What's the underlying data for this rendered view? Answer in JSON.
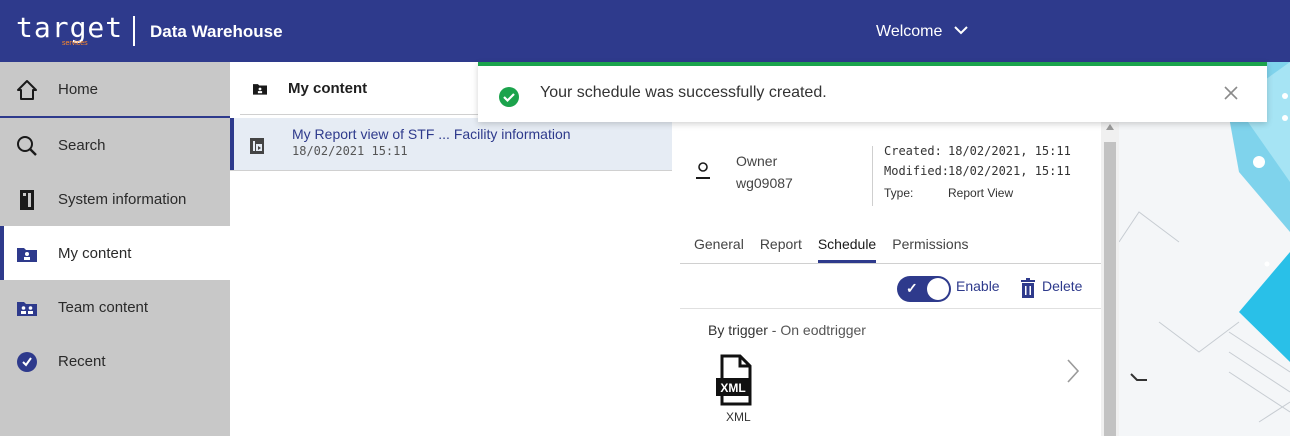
{
  "header": {
    "logo": "target",
    "logo_sub": "services",
    "app_title": "Data Warehouse",
    "welcome": "Welcome"
  },
  "sidebar": {
    "items": [
      {
        "label": "Home",
        "icon": "home-icon"
      },
      {
        "label": "Search",
        "icon": "search-icon"
      },
      {
        "label": "System information",
        "icon": "system-info-icon"
      },
      {
        "label": "My content",
        "icon": "folder-user-icon",
        "active": true
      },
      {
        "label": "Team content",
        "icon": "folder-team-icon"
      },
      {
        "label": "Recent",
        "icon": "clock-icon"
      }
    ]
  },
  "content": {
    "title": "My content",
    "rows": [
      {
        "title": "My Report view of STF ... Facility information",
        "date": "18/02/2021 15:11",
        "icon": "report-view-icon"
      }
    ]
  },
  "toast": {
    "message": "Your schedule was successfully created.",
    "icon": "check-circle-icon"
  },
  "detail": {
    "owner_label": "Owner",
    "owner_id": "wg09087",
    "created_key": "Created:",
    "created_val": "18/02/2021, 15:11",
    "modified_key": "Modified:",
    "modified_val": "18/02/2021, 15:11",
    "type_key": "Type:",
    "type_val": "Report View",
    "tabs": [
      "General",
      "Report",
      "Schedule",
      "Permissions"
    ],
    "active_tab": "Schedule",
    "enable_label": "Enable",
    "enabled": true,
    "delete_label": "Delete",
    "trigger_label": "By trigger",
    "trigger_sub": " - On eodtrigger",
    "format_label": "XML",
    "format_icon_text": "XML"
  },
  "colors": {
    "brand": "#2e3a8c",
    "success": "#1ba34c",
    "sidebar_bg": "#c8c8c8",
    "selected_row": "#e6ecf4"
  }
}
